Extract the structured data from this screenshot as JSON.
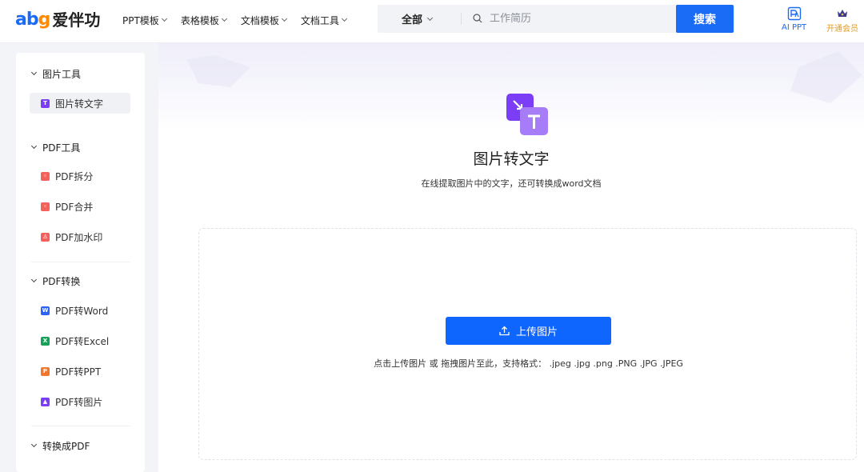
{
  "header": {
    "logo_mark_a": "ab",
    "logo_mark_g": "g",
    "logo_text": "爱伴功",
    "nav": [
      {
        "label": "PPT模板"
      },
      {
        "label": "表格模板"
      },
      {
        "label": "文档模板"
      },
      {
        "label": "文档工具"
      }
    ],
    "search": {
      "category": "全部",
      "placeholder": "工作简历",
      "button_label": "搜索"
    },
    "ai_ppt_label": "AI PPT",
    "vip_label": "开通会员",
    "colors": {
      "brand": "#1a6bf5",
      "vip": "#e09b1f"
    }
  },
  "sidebar": {
    "groups": [
      {
        "label": "图片工具",
        "items": [
          {
            "label": "图片转文字",
            "icon": "image-to-text-icon",
            "icon_char": "T",
            "color": "#7b3ef6",
            "active": true
          }
        ]
      },
      {
        "label": "PDF工具",
        "items": [
          {
            "label": "PDF拆分",
            "icon": "pdf-split-icon",
            "icon_char": "◦",
            "color": "#f4605b"
          },
          {
            "label": "PDF合并",
            "icon": "pdf-merge-icon",
            "icon_char": "◦",
            "color": "#f4605b"
          },
          {
            "label": "PDF加水印",
            "icon": "pdf-watermark-icon",
            "icon_char": "♙",
            "color": "#f4605b"
          }
        ]
      },
      {
        "label": "PDF转换",
        "items": [
          {
            "label": "PDF转Word",
            "icon": "word-icon",
            "icon_char": "W",
            "color": "#2a64f6"
          },
          {
            "label": "PDF转Excel",
            "icon": "excel-icon",
            "icon_char": "X",
            "color": "#19a05a"
          },
          {
            "label": "PDF转PPT",
            "icon": "ppt-icon",
            "icon_char": "P",
            "color": "#f2762e"
          },
          {
            "label": "PDF转图片",
            "icon": "image-icon",
            "icon_char": "▲",
            "color": "#7b3ef6"
          }
        ]
      },
      {
        "label": "转换成PDF",
        "items": []
      }
    ]
  },
  "main": {
    "title": "图片转文字",
    "subtitle": "在线提取图片中的文字，还可转换成word文档",
    "upload_button": "上传图片",
    "upload_hint": "点击上传图片 或 拖拽图片至此，支持格式： .jpeg .jpg .png .PNG .JPG .JPEG",
    "accent": "#0f66ff"
  }
}
